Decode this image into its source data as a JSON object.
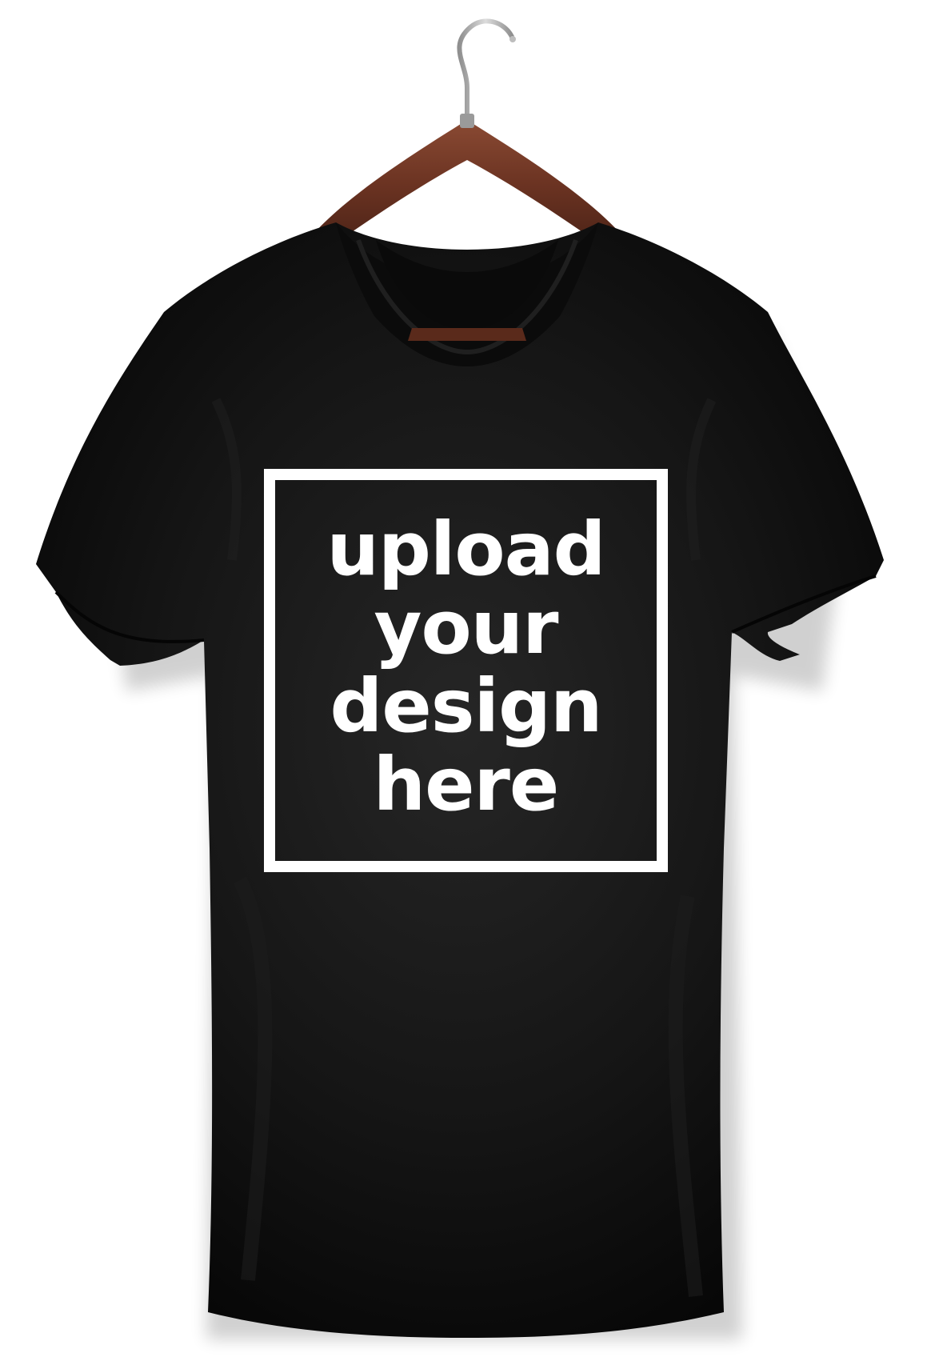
{
  "product": {
    "name": "t-shirt",
    "shirt_color": "#0d0d0d",
    "hanger_color": "#6b3322",
    "hook_color": "#b0b0b0"
  },
  "print_area": {
    "border_color": "#ffffff",
    "text_color": "#ffffff",
    "lines": [
      "upload",
      "your",
      "design",
      "here"
    ]
  }
}
